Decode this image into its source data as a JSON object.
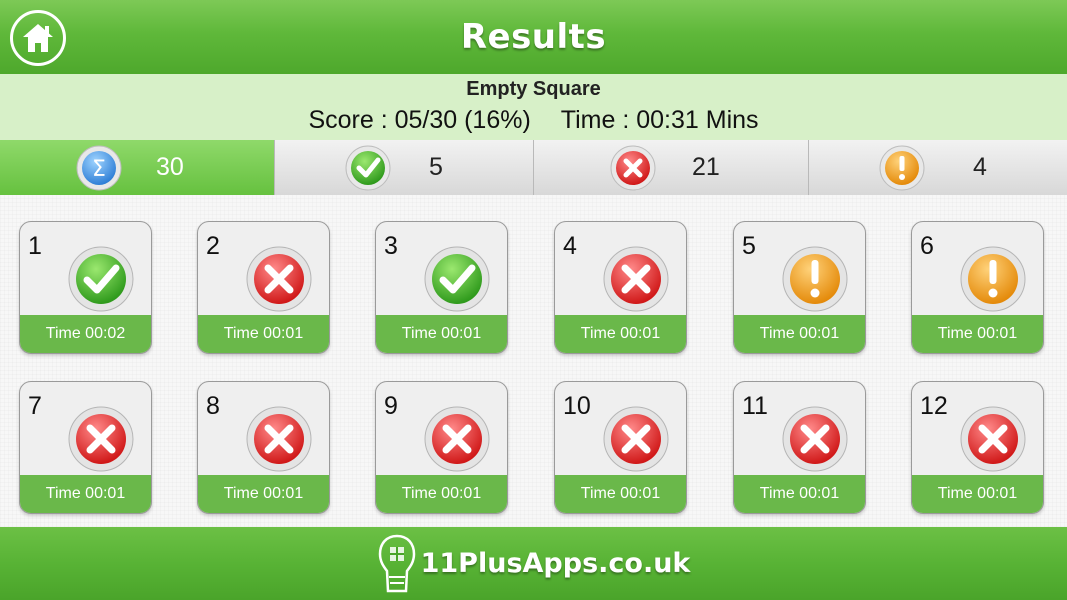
{
  "header": {
    "title": "Results"
  },
  "info": {
    "quiz_name": "Empty Square",
    "score_text": "Score : 05/30 (16%)",
    "time_text": "Time : 00:31 Mins"
  },
  "summary": [
    {
      "icon": "sigma-icon",
      "count": "30",
      "active": true
    },
    {
      "icon": "check-icon",
      "count": "5",
      "active": false
    },
    {
      "icon": "cross-icon",
      "count": "21",
      "active": false
    },
    {
      "icon": "exclamation-icon",
      "count": "4",
      "active": false
    }
  ],
  "questions": [
    {
      "number": "1",
      "status": "correct",
      "time": "Time 00:02"
    },
    {
      "number": "2",
      "status": "wrong",
      "time": "Time 00:01"
    },
    {
      "number": "3",
      "status": "correct",
      "time": "Time 00:01"
    },
    {
      "number": "4",
      "status": "wrong",
      "time": "Time 00:01"
    },
    {
      "number": "5",
      "status": "skipped",
      "time": "Time 00:01"
    },
    {
      "number": "6",
      "status": "skipped",
      "time": "Time 00:01"
    },
    {
      "number": "7",
      "status": "wrong",
      "time": "Time 00:01"
    },
    {
      "number": "8",
      "status": "wrong",
      "time": "Time 00:01"
    },
    {
      "number": "9",
      "status": "wrong",
      "time": "Time 00:01"
    },
    {
      "number": "10",
      "status": "wrong",
      "time": "Time 00:01"
    },
    {
      "number": "11",
      "status": "wrong",
      "time": "Time 00:01"
    },
    {
      "number": "12",
      "status": "wrong",
      "time": "Time 00:01"
    }
  ],
  "footer": {
    "brand": "11PlusApps.co.uk",
    "logo_icon": "head-logo-icon"
  },
  "colors": {
    "header_green": "#5fb83a",
    "info_band": "#d7f0c8",
    "time_bar": "#6ab84a",
    "correct": "#3fae2a",
    "wrong": "#e02424",
    "skipped": "#f0a018",
    "sigma": "#3a8ee0"
  }
}
